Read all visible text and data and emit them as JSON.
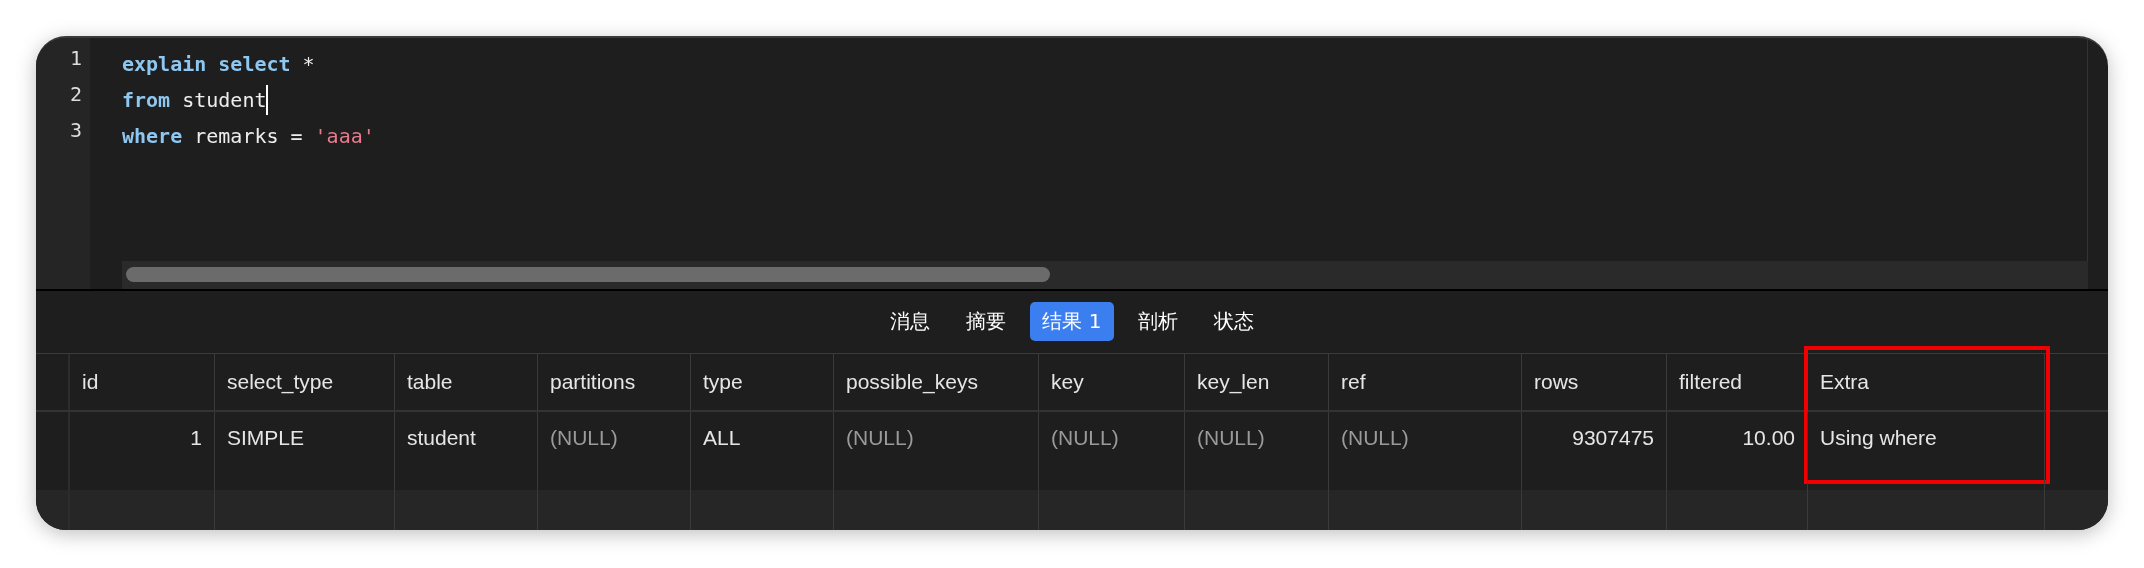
{
  "editor": {
    "lines": [
      {
        "cursor": false,
        "tokens": [
          {
            "kind": "keyword",
            "text": "explain"
          },
          {
            "kind": "keyword",
            "text": "select"
          },
          {
            "kind": "plain",
            "text": "*"
          }
        ]
      },
      {
        "cursor": true,
        "tokens": [
          {
            "kind": "keyword",
            "text": "from"
          },
          {
            "kind": "plain",
            "text": "student"
          }
        ]
      },
      {
        "cursor": false,
        "tokens": [
          {
            "kind": "keyword",
            "text": "where"
          },
          {
            "kind": "plain",
            "text": "remarks"
          },
          {
            "kind": "plain",
            "text": "="
          },
          {
            "kind": "string",
            "text": "'aaa'"
          }
        ]
      }
    ],
    "line_numbers": [
      "1",
      "2",
      "3"
    ]
  },
  "tabs": [
    {
      "label": "消息",
      "selected": false
    },
    {
      "label": "摘要",
      "selected": false
    },
    {
      "label": "结果 1",
      "selected": true
    },
    {
      "label": "剖析",
      "selected": false
    },
    {
      "label": "状态",
      "selected": false
    }
  ],
  "table": {
    "columns": [
      {
        "name": "id",
        "numeric": true,
        "highlighted": false
      },
      {
        "name": "select_type",
        "numeric": false,
        "highlighted": false
      },
      {
        "name": "table",
        "numeric": false,
        "highlighted": false
      },
      {
        "name": "partitions",
        "numeric": false,
        "highlighted": false
      },
      {
        "name": "type",
        "numeric": false,
        "highlighted": false
      },
      {
        "name": "possible_keys",
        "numeric": false,
        "highlighted": false
      },
      {
        "name": "key",
        "numeric": false,
        "highlighted": false
      },
      {
        "name": "key_len",
        "numeric": false,
        "highlighted": false
      },
      {
        "name": "ref",
        "numeric": false,
        "highlighted": false
      },
      {
        "name": "rows",
        "numeric": true,
        "highlighted": false
      },
      {
        "name": "filtered",
        "numeric": true,
        "highlighted": false
      },
      {
        "name": "Extra",
        "numeric": false,
        "highlighted": true
      }
    ],
    "rows": [
      [
        {
          "text": "1",
          "null": false
        },
        {
          "text": "SIMPLE",
          "null": false
        },
        {
          "text": "student",
          "null": false
        },
        {
          "text": "(NULL)",
          "null": true
        },
        {
          "text": "ALL",
          "null": false
        },
        {
          "text": "(NULL)",
          "null": true
        },
        {
          "text": "(NULL)",
          "null": true
        },
        {
          "text": "(NULL)",
          "null": true
        },
        {
          "text": "(NULL)",
          "null": true
        },
        {
          "text": "9307475",
          "null": false
        },
        {
          "text": "10.00",
          "null": false
        },
        {
          "text": "Using where",
          "null": false
        }
      ]
    ]
  }
}
